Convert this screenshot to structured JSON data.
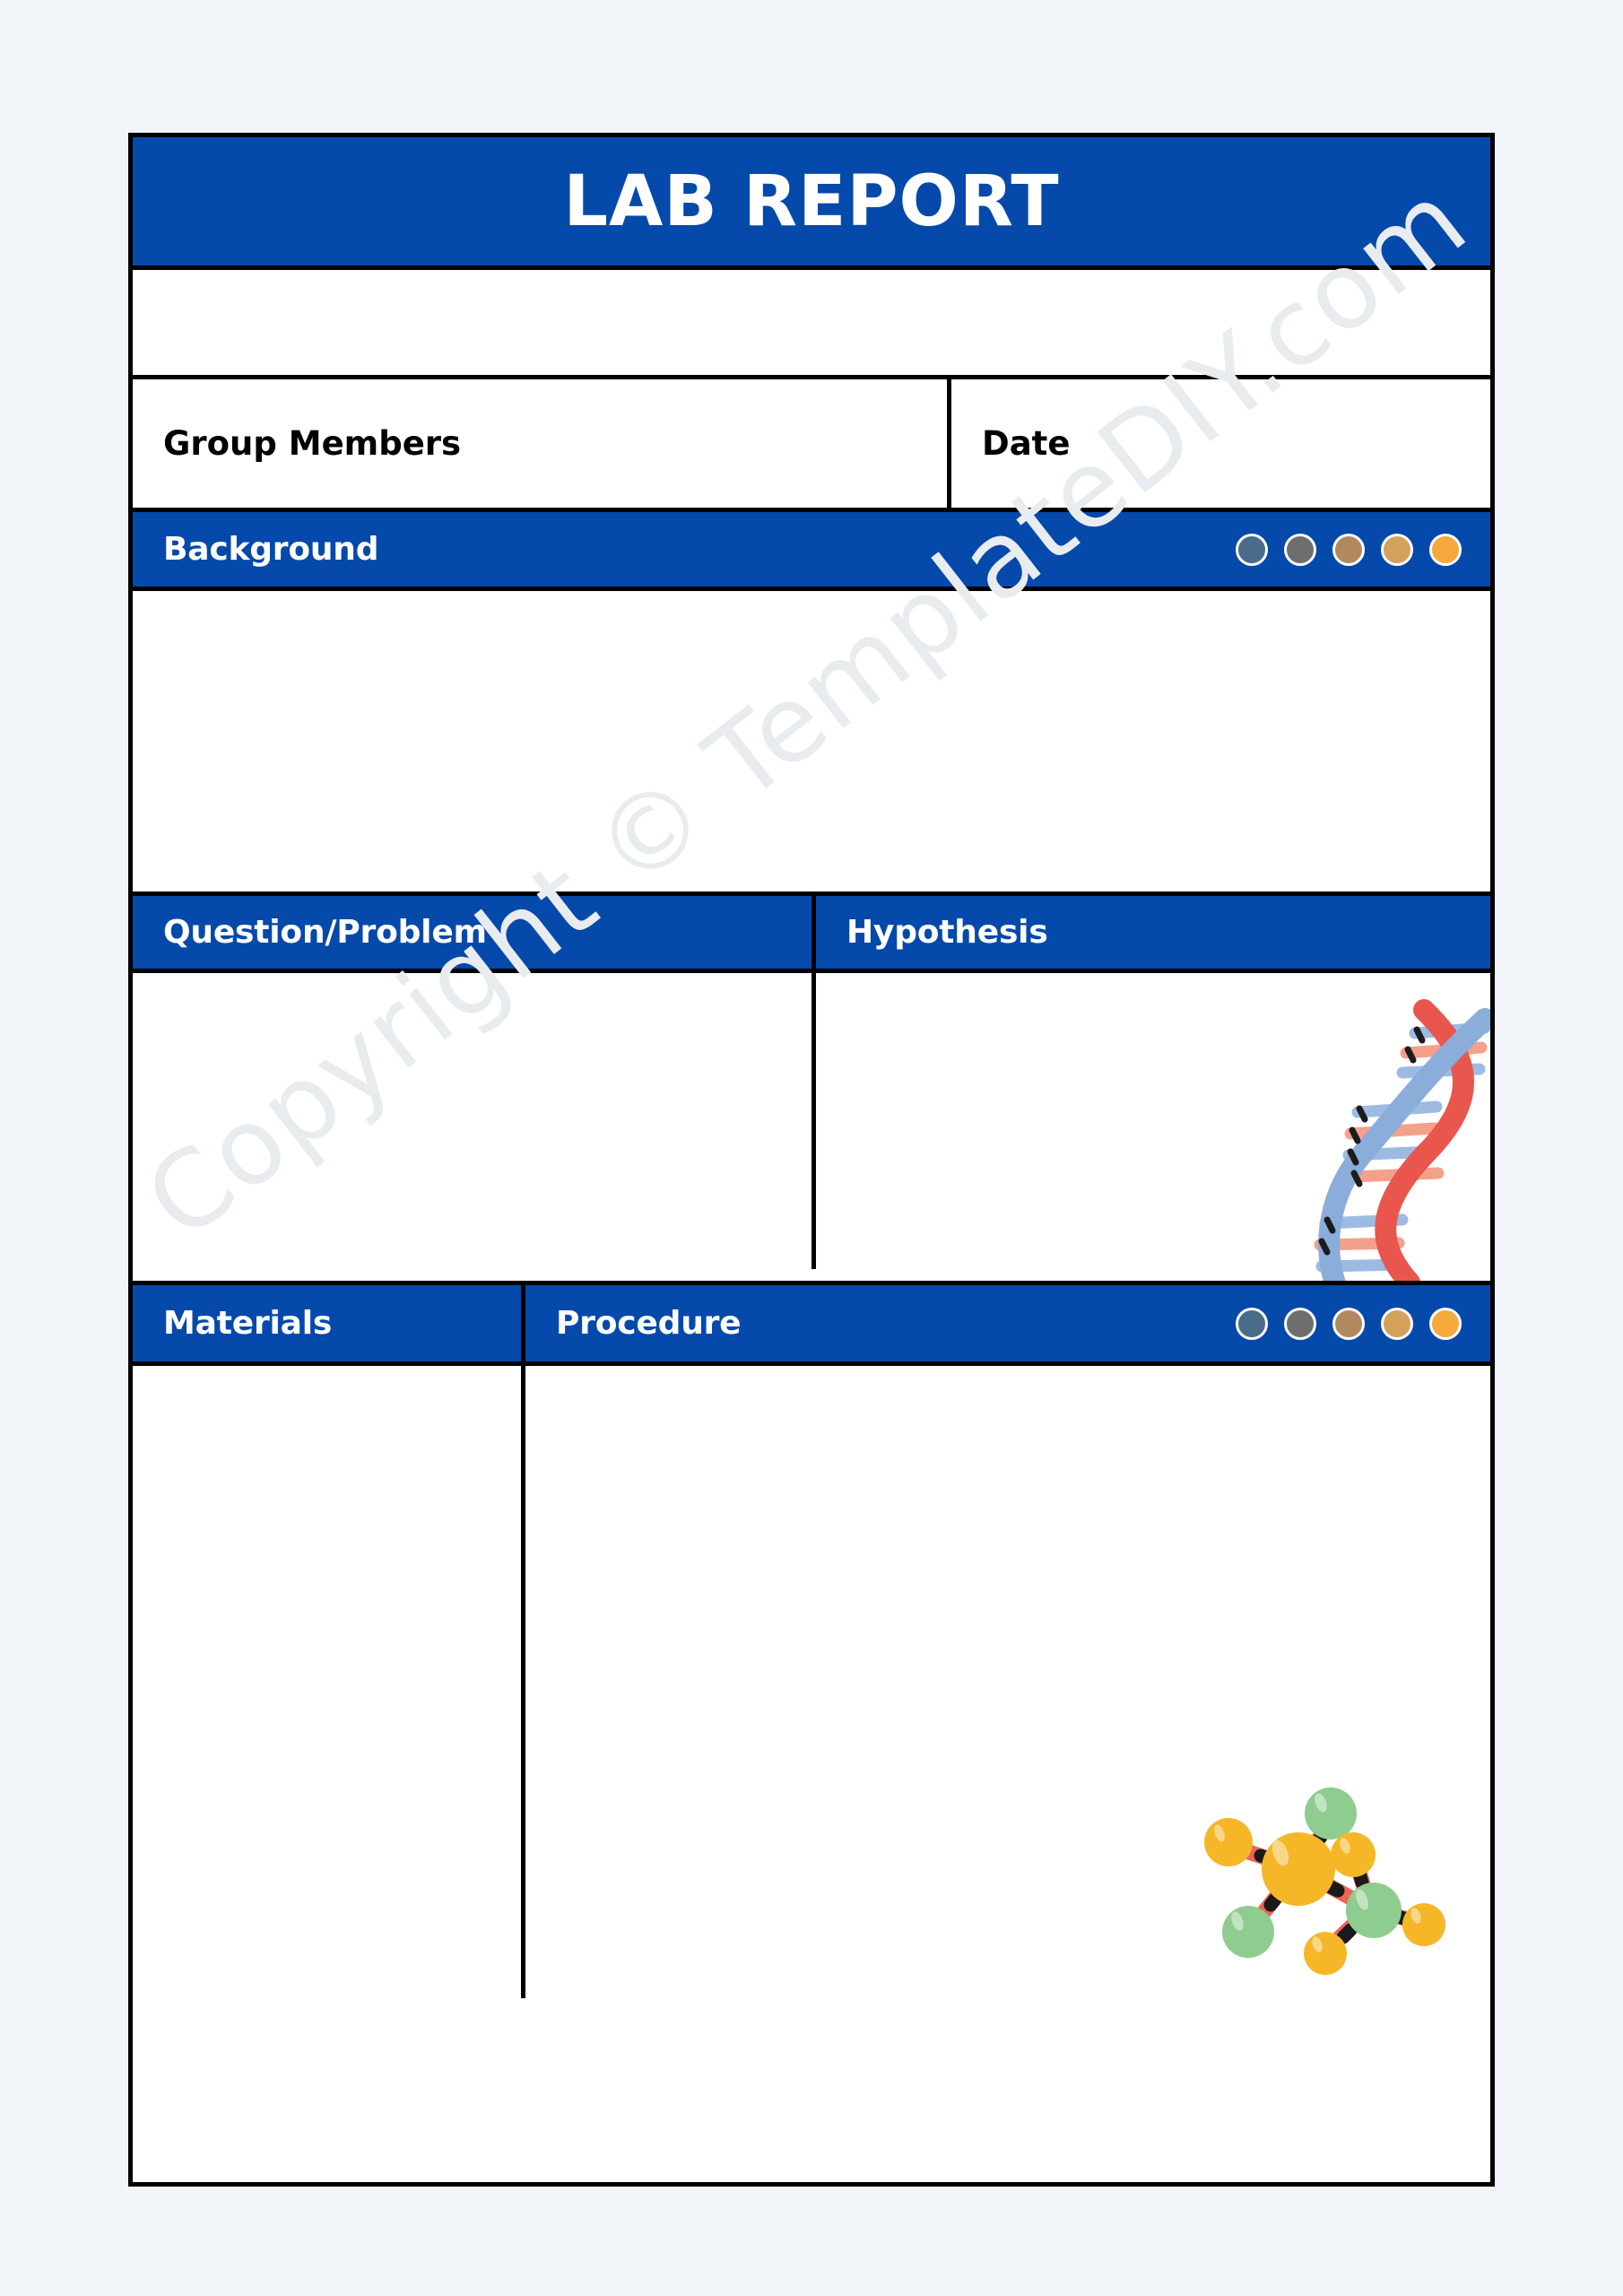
{
  "document": {
    "title": "LAB REPORT",
    "accent_color": "#0549ab",
    "border_color": "#000000",
    "page_background": "#f1f5f9",
    "sheet_background": "#ffffff"
  },
  "watermark": {
    "text": "Copyright © TemplateDIY.com",
    "color": "#e9ecef"
  },
  "fields": {
    "name_row_value": "",
    "group_members_label": "Group Members",
    "group_members_value": "",
    "date_label": "Date",
    "date_value": ""
  },
  "sections": {
    "background": {
      "label": "Background",
      "value": ""
    },
    "question": {
      "label": "Question/Problem",
      "value": ""
    },
    "hypothesis": {
      "label": "Hypothesis",
      "value": ""
    },
    "materials": {
      "label": "Materials",
      "value": ""
    },
    "procedure": {
      "label": "Procedure",
      "value": ""
    }
  },
  "decor": {
    "dot_colors": [
      "#4a6b8a",
      "#6e6e6e",
      "#b08a5e",
      "#d4a15c",
      "#f5a93c"
    ],
    "dna_icon": "dna-helix-icon",
    "molecule_icon": "molecule-icon",
    "dna_colors": {
      "strand_red": "#e8564d",
      "strand_blue": "#8aadd9",
      "rung_salmon": "#f4a08a",
      "rung_blue": "#9dbbe2"
    },
    "molecule_colors": {
      "atom_yellow": "#f5b728",
      "atom_green": "#8fcc8f",
      "bond_red": "#ef6355",
      "joint": "#1a1a1a"
    }
  }
}
